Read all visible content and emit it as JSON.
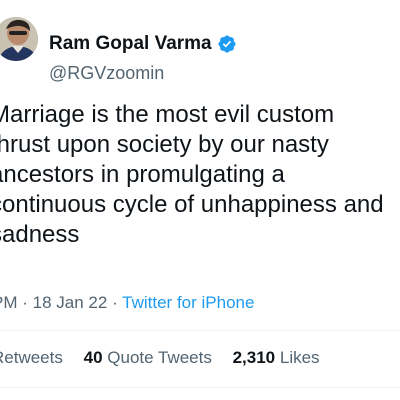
{
  "user": {
    "display_name": "Ram Gopal Varma",
    "handle": "@RGVzoomin",
    "verified": true,
    "verified_color": "#1d9bf0",
    "avatar_icon": "profile-photo"
  },
  "tweet": {
    "lines": [
      "Marriage is the most evil custom",
      "thrust upon society by our nasty",
      "ancestors in promulgating a",
      "continuous cycle of unhappiness and",
      "sadness"
    ]
  },
  "meta": {
    "time": "PM",
    "separator": "·",
    "date": "18 Jan 22",
    "source": "Twitter for iPhone"
  },
  "stats": {
    "retweets_count": "",
    "retweets_label": "Retweets",
    "quote_count": "40",
    "quote_label": "Quote Tweets",
    "likes_count": "2,310",
    "likes_label": "Likes"
  },
  "colors": {
    "text": "#0f1419",
    "secondary": "#536471",
    "accent": "#1d9bf0",
    "divider": "#eff3f4"
  }
}
